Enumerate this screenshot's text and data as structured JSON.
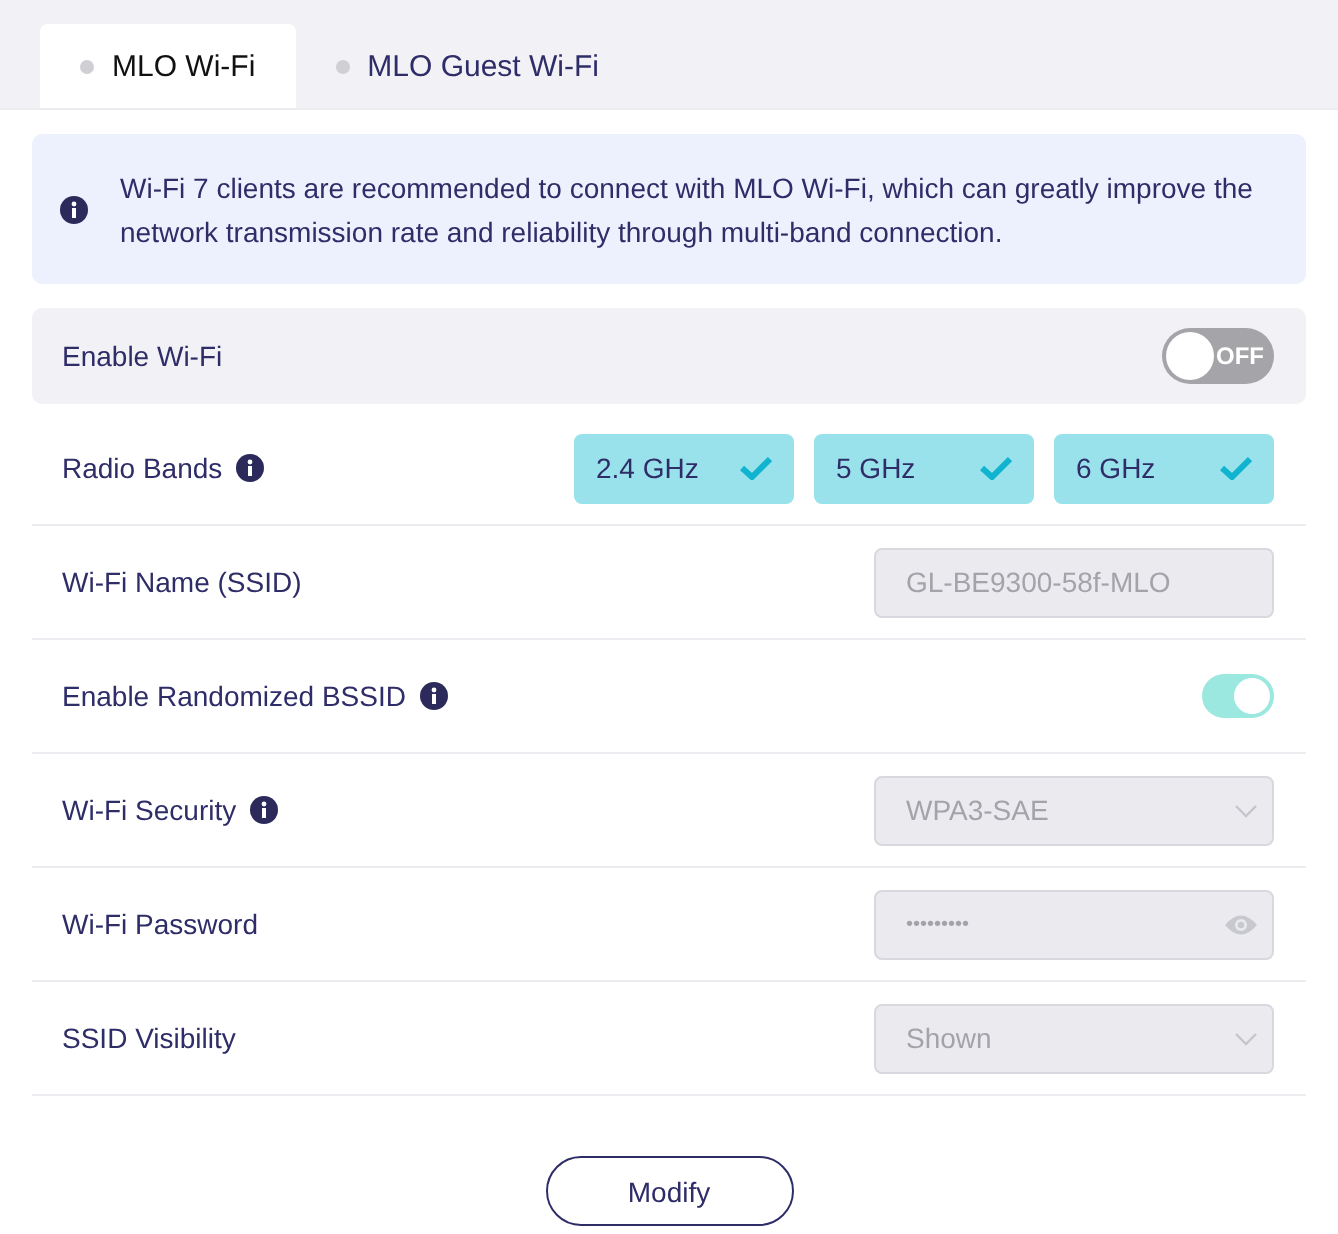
{
  "tabs": [
    {
      "label": "MLO Wi-Fi",
      "selected": true
    },
    {
      "label": "MLO Guest Wi-Fi",
      "selected": false
    }
  ],
  "notice": {
    "text": "Wi-Fi 7 clients are recommended to connect with MLO Wi-Fi, which can greatly improve the network transmission rate and reliability through multi-band connection."
  },
  "rows": [
    {
      "kind": "toggle",
      "label": "Enable Wi-Fi",
      "info": false,
      "on": false,
      "state_text": "OFF",
      "highlighted": true
    },
    {
      "kind": "bands",
      "label": "Radio Bands",
      "info": true,
      "bands": [
        {
          "label": "2.4 GHz",
          "checked": true
        },
        {
          "label": "5 GHz",
          "checked": true
        },
        {
          "label": "6 GHz",
          "checked": true
        }
      ]
    },
    {
      "kind": "text",
      "label": "Wi-Fi Name (SSID)",
      "info": false,
      "value": "GL-BE9300-58f-MLO",
      "disabled": true
    },
    {
      "kind": "toggle",
      "label": "Enable Randomized BSSID",
      "info": true,
      "on": true
    },
    {
      "kind": "select",
      "label": "Wi-Fi Security",
      "info": true,
      "value": "WPA3-SAE",
      "disabled": true
    },
    {
      "kind": "password",
      "label": "Wi-Fi Password",
      "info": false,
      "value": "•••••••••",
      "disabled": true
    },
    {
      "kind": "select",
      "label": "SSID Visibility",
      "info": false,
      "value": "Shown",
      "disabled": true
    }
  ],
  "button": {
    "label": "Modify"
  }
}
